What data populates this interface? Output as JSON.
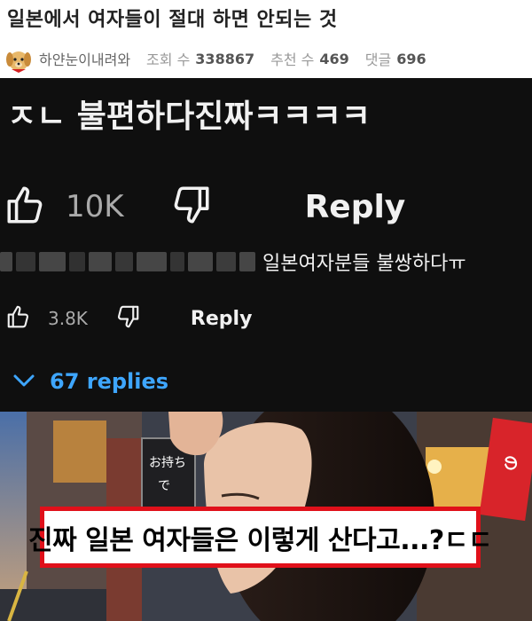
{
  "post": {
    "title": "일본에서 여자들이 절대 하면 안되는 것",
    "author": "하얀눈이내려와",
    "views_label": "조회 수",
    "views": "338867",
    "likes_label": "추천 수",
    "likes": "469",
    "comments_label": "댓글",
    "comments": "696"
  },
  "comment1": {
    "text": "ㅈㄴ 불편하다진짜ㅋㅋㅋㅋ",
    "like_count": "10K",
    "reply_label": "Reply"
  },
  "comment2": {
    "text": "일본여자분들 불쌍하다ㅠ",
    "like_count": "3.8K",
    "reply_label": "Reply"
  },
  "replies": {
    "label": "67 replies"
  },
  "scene": {
    "caption": "진짜 일본 여자들은 이렇게 산다고...?ㄷㄷ",
    "caption_border_color": "#e0101a",
    "sign_text": "お持ち\nで",
    "banner_text": "の"
  }
}
